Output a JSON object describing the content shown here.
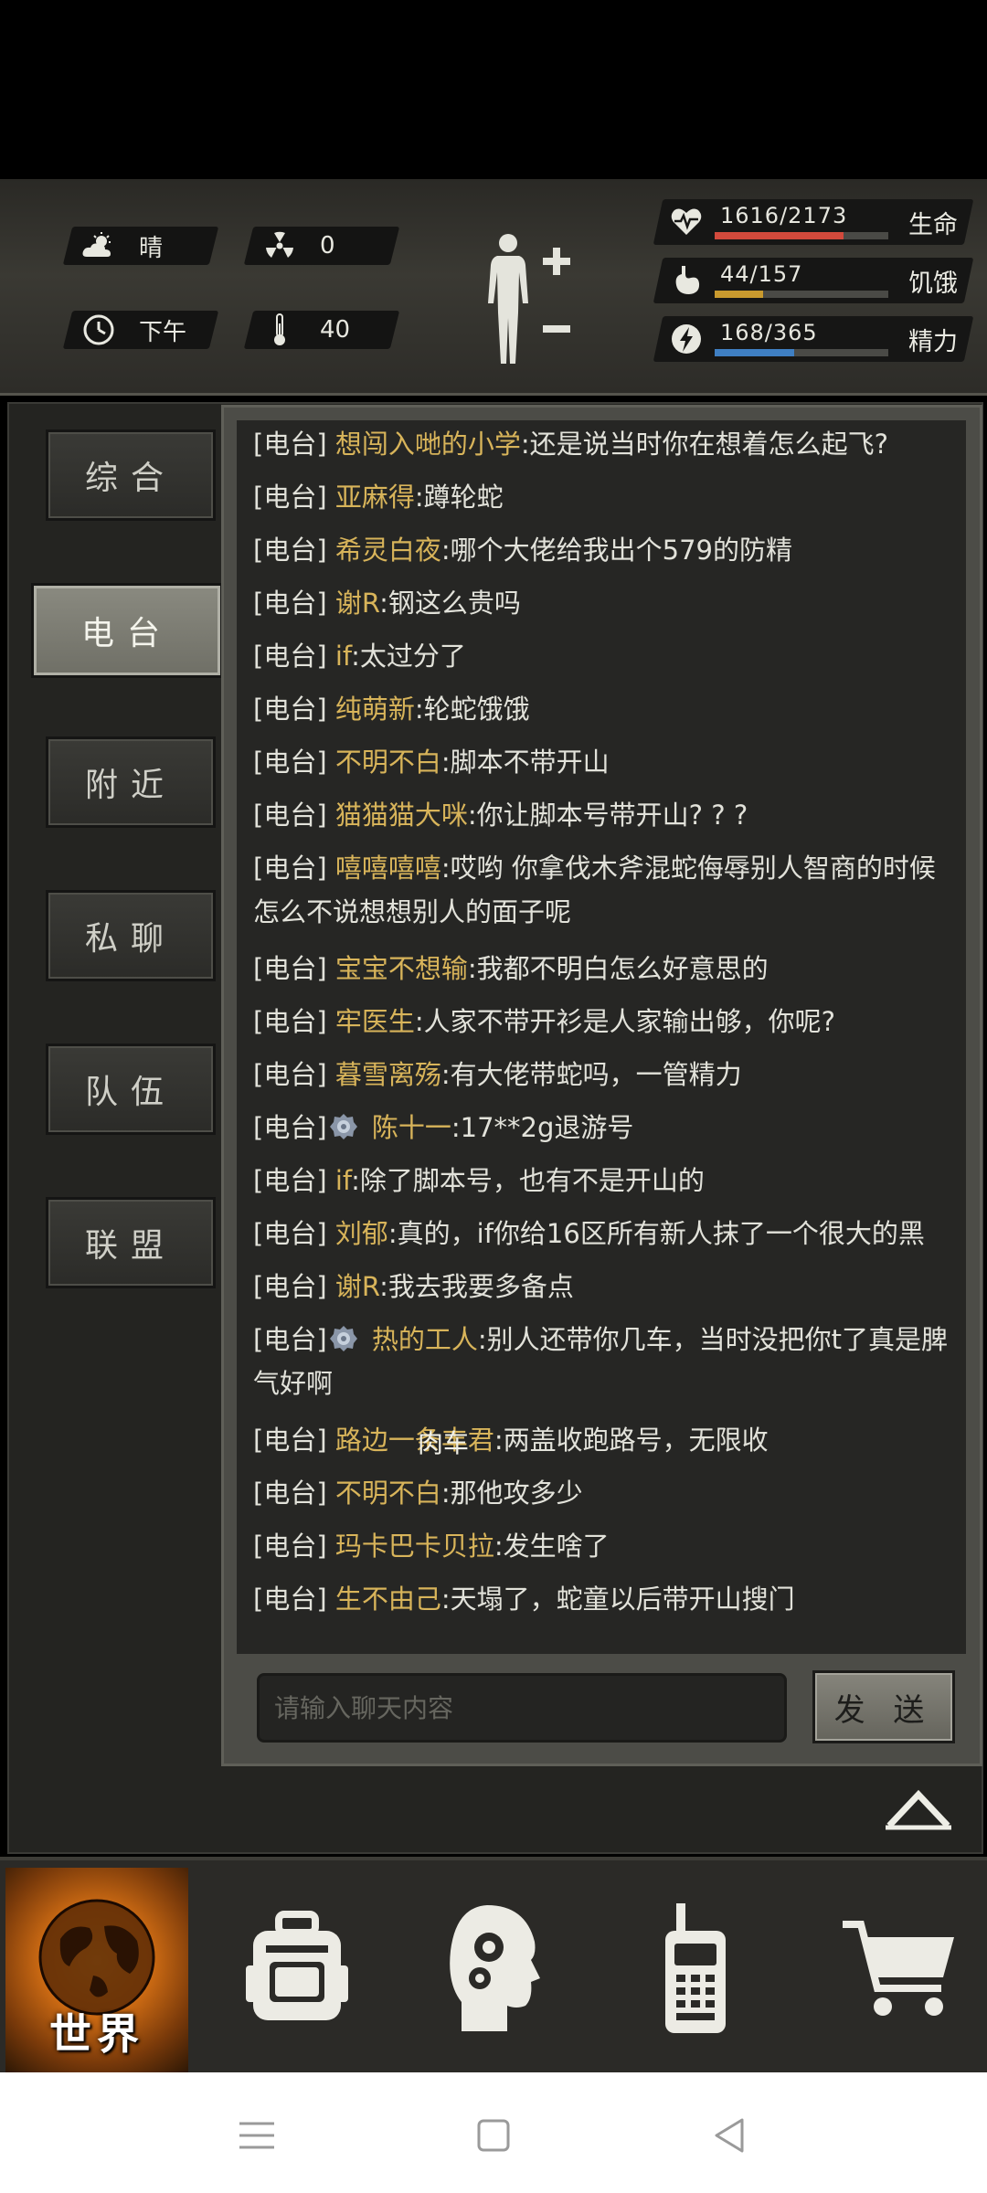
{
  "status": {
    "weather": "晴",
    "radiation": "0",
    "time_of_day": "下午",
    "temperature": "40"
  },
  "vitals": [
    {
      "name": "生命",
      "value": "1616/2173",
      "current": 1616,
      "max": 2173,
      "color": "#d24a3c",
      "icon": "heart-icon"
    },
    {
      "name": "饥饿",
      "value": "44/157",
      "current": 44,
      "max": 157,
      "color": "#c99a2e",
      "icon": "stomach-icon"
    },
    {
      "name": "精力",
      "value": "168/365",
      "current": 168,
      "max": 365,
      "color": "#3f7fc2",
      "icon": "energy-icon"
    }
  ],
  "tabs": [
    "综合",
    "电台",
    "附近",
    "私聊",
    "队伍",
    "联盟"
  ],
  "active_tab": "电台",
  "channel_tag": "[电台]",
  "messages": [
    {
      "name": "想闯入哋的小学",
      "text": ":还是说当时你在想着怎么起飞?"
    },
    {
      "name": "亚麻得",
      "text": ":蹲轮蛇"
    },
    {
      "name": "希灵白夜",
      "text": ":哪个大佬给我出个579的防精"
    },
    {
      "name": "谢R",
      "text": ":钢这么贵吗"
    },
    {
      "name": "if",
      "text": ":太过分了"
    },
    {
      "name": "纯萌新",
      "text": ":轮蛇饿饿"
    },
    {
      "name": "不明不白",
      "text": ":脚本不带开山"
    },
    {
      "name": "猫猫猫大咪",
      "text": ":你让脚本号带开山? ? ?"
    },
    {
      "name": "嘻嘻嘻嘻",
      "text": ":哎哟 你拿伐木斧混蛇侮辱别人智商的时候",
      "text2": "怎么不说想想别人的面子呢"
    },
    {
      "name": "宝宝不想输",
      "text": ":我都不明白怎么好意思的"
    },
    {
      "name": "牢医生",
      "text": ":人家不带开衫是人家输出够，你呢?"
    },
    {
      "name": "暮雪离殇",
      "text": ":有大佬带蛇吗，一管精力"
    },
    {
      "name": "陈十一",
      "text": ":17**2g退游号",
      "badge": true
    },
    {
      "name": "if",
      "text": ":除了脚本号，也有不是开山的"
    },
    {
      "name": "刘郁",
      "text": ":真的，if你给16区所有新人抹了一个很大的黑"
    },
    {
      "name": "谢R",
      "text": ":我去我要多备点"
    },
    {
      "name": "热的工人",
      "text": ":别人还带你几车，当时没把你t了真是脾",
      "text2": "气好啊",
      "badge": true
    },
    {
      "name": "路边一条丰君",
      "text": ":两盖收跑路号，无限收",
      "overlay": "肉车"
    },
    {
      "name": "不明不白",
      "text": ":那他攻多少"
    },
    {
      "name": "玛卡巴卡贝拉",
      "text": ":发生啥了"
    },
    {
      "name": "生不由己",
      "text": ":天塌了，蛇童以后带开山搜门"
    }
  ],
  "input": {
    "placeholder": "请输入聊天内容",
    "value": ""
  },
  "send_label": "发 送",
  "bottom_nav": {
    "world_label": "世界",
    "items": [
      "backpack-icon",
      "skills-head-icon",
      "radio-device-icon",
      "shop-cart-icon"
    ]
  }
}
